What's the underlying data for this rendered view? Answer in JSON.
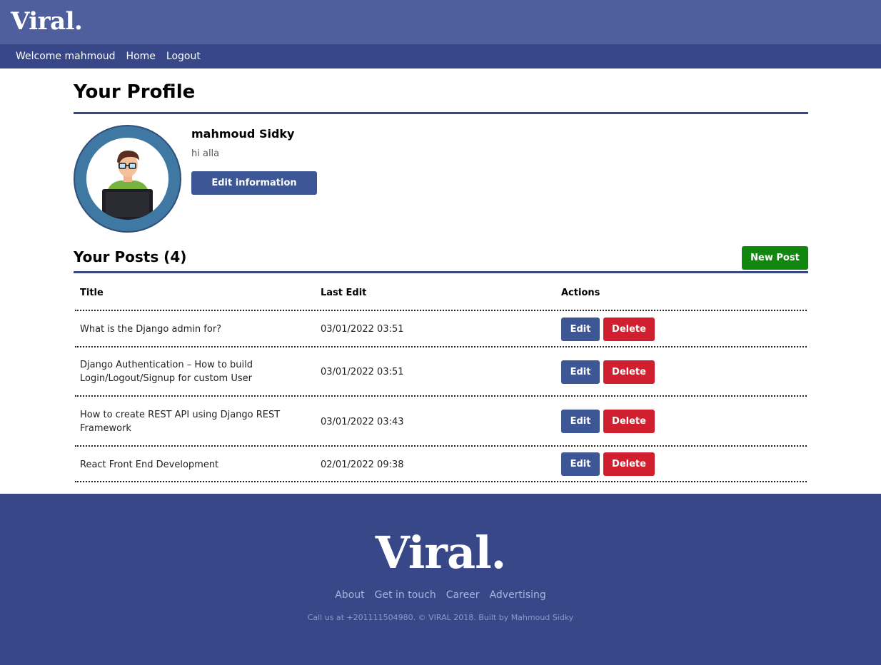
{
  "brand": {
    "logo": "Viral."
  },
  "nav": {
    "welcome": "Welcome mahmoud",
    "home": "Home",
    "logout": "Logout"
  },
  "profile": {
    "title": "Your Profile",
    "name": "mahmoud Sidky",
    "bio": "hi alla",
    "edit_button": "Edit information"
  },
  "posts": {
    "title": "Your Posts (4)",
    "new_button": "New Post",
    "columns": [
      "Title",
      "Last Edit",
      "Actions"
    ],
    "rows": [
      {
        "title": "What is the Django admin for?",
        "last_edit": "03/01/2022 03:51",
        "edit": "Edit",
        "delete": "Delete"
      },
      {
        "title": "Django Authentication – How to build Login/Logout/Signup for custom User",
        "last_edit": "03/01/2022 03:51",
        "edit": "Edit",
        "delete": "Delete"
      },
      {
        "title": "How to create REST API using Django REST Framework",
        "last_edit": "03/01/2022 03:43",
        "edit": "Edit",
        "delete": "Delete"
      },
      {
        "title": "React Front End Development",
        "last_edit": "02/01/2022 09:38",
        "edit": "Edit",
        "delete": "Delete"
      }
    ]
  },
  "footer": {
    "logo": "Viral.",
    "links": [
      "About",
      "Get in touch",
      "Career",
      "Advertising"
    ],
    "copyright": "Call us at +201111504980. © VIRAL 2018. Built by Mahmoud Sidky"
  },
  "colors": {
    "header": "#4f5f9d",
    "nav": "#374788",
    "primary_button": "#3d5696",
    "new_post_button": "#12870f",
    "delete_button": "#d0202f"
  },
  "icons": {
    "avatar": "developer-at-computer-illustration"
  }
}
